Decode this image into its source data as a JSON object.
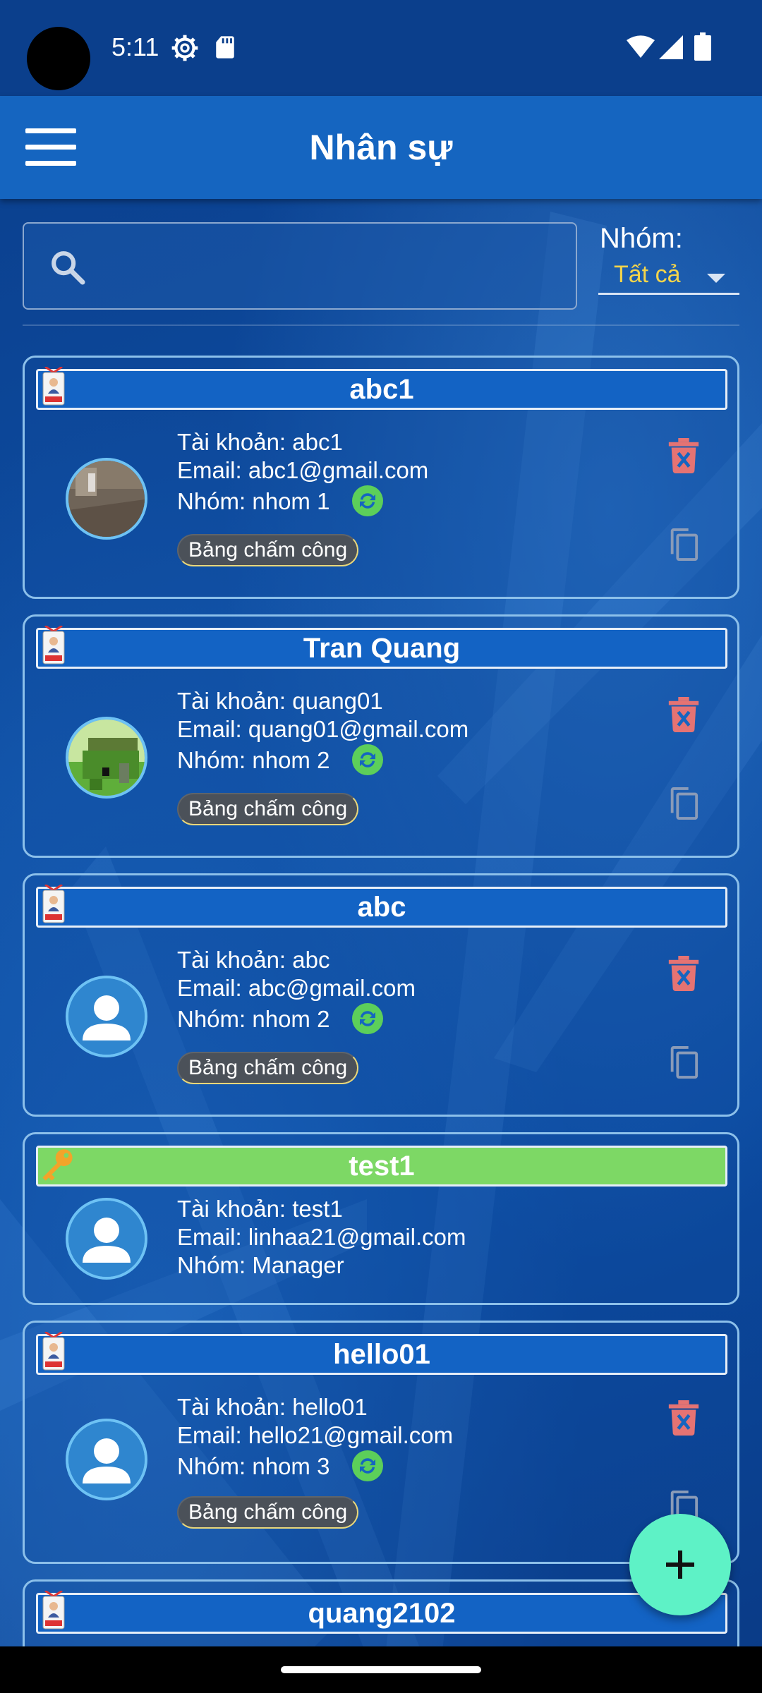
{
  "status_bar": {
    "time": "5:11"
  },
  "app_bar": {
    "title": "Nhân sự"
  },
  "filters": {
    "search_placeholder": "",
    "group_label": "Nhóm:",
    "group_value": "Tất cả"
  },
  "labels": {
    "account_prefix": "Tài khoản: ",
    "email_prefix": "Email: ",
    "group_prefix": "Nhóm:  ",
    "timesheet_chip": "Bảng chấm công"
  },
  "employees": [
    {
      "name": "abc1",
      "account": "Tài khoản: abc1",
      "email": "Email: abc1@gmail.com",
      "group": "Nhóm:  nhom 1",
      "role_icon": "staff-icon",
      "avatar": "photo",
      "timesheet": "Bảng chấm công"
    },
    {
      "name": "Tran Quang",
      "account": "Tài khoản: quang01",
      "email": "Email: quang01@gmail.com",
      "group": "Nhóm:  nhom 2",
      "role_icon": "staff-icon",
      "avatar": "pixel-art",
      "timesheet": "Bảng chấm công"
    },
    {
      "name": "abc",
      "account": "Tài khoản: abc",
      "email": "Email: abc@gmail.com",
      "group": "Nhóm:  nhom 2",
      "role_icon": "staff-icon",
      "avatar": "default",
      "timesheet": "Bảng chấm công"
    },
    {
      "name": "test1",
      "account": "Tài khoản: test1",
      "email": "Email: linhaa21@gmail.com",
      "group": "Nhóm:  Manager",
      "role_icon": "key-icon",
      "avatar": "default"
    },
    {
      "name": "hello01",
      "account": "Tài khoản: hello01",
      "email": "Email: hello21@gmail.com",
      "group": "Nhóm:  nhom 3",
      "role_icon": "staff-icon",
      "avatar": "default",
      "timesheet": "Bảng chấm công"
    },
    {
      "name": "quang2102",
      "role_icon": "staff-icon"
    }
  ],
  "colors": {
    "app_bar": "#1565c0",
    "manager_header": "#7dd865",
    "fab": "#5ef2c6",
    "delete": "#e57373",
    "sync": "#5ccf5a",
    "group_value": "#f3d44b"
  }
}
